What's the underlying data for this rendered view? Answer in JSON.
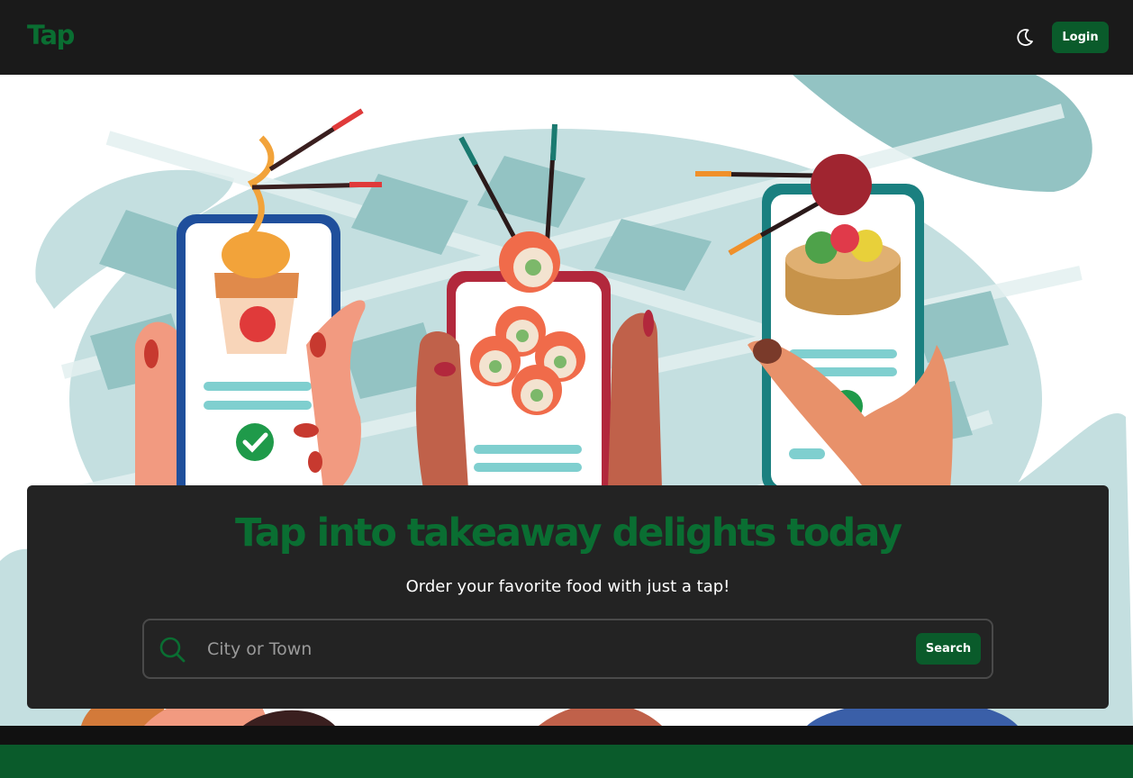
{
  "header": {
    "logo_text": "Tap",
    "theme_toggle_icon": "moon-icon",
    "login_label": "Login"
  },
  "hero": {
    "illustration": "phones-with-takeaway-food-illustration",
    "headline": "Tap into takeaway delights today",
    "subheadline": "Order your favorite food with just a tap!"
  },
  "search": {
    "icon": "search-icon",
    "placeholder": "City or Town",
    "value": "",
    "button_label": "Search"
  },
  "colors": {
    "brand_green": "#0a6e32",
    "button_green": "#0a5b2b",
    "nav_background": "#1a1a1a",
    "card_background": "#232323",
    "map_teal": "#c4dfe0",
    "map_teal_dark": "#93c3c3"
  }
}
